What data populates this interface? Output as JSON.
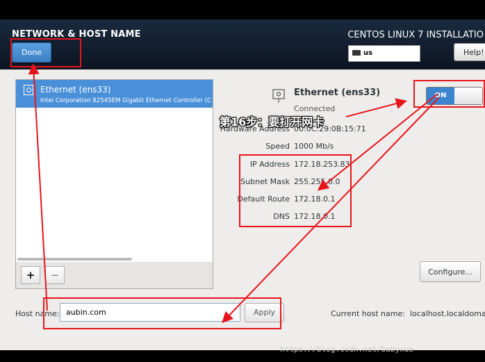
{
  "header": {
    "title": "NETWORK & HOST NAME",
    "done_label": "Done",
    "install_title": "CENTOS LINUX 7 INSTALLATIO",
    "keyboard_layout": "us",
    "help_label": "Help!"
  },
  "connections": {
    "items": [
      {
        "name": "Ethernet (ens33)",
        "description": "Intel Corporation 82545EM Gigabit Ethernet Controller (C"
      }
    ],
    "add_label": "+",
    "remove_label": "−"
  },
  "detail": {
    "name": "Ethernet (ens33)",
    "status": "Connected",
    "toggle_label": "ON",
    "toggle_on": true,
    "hardware_address_label": "Hardware Address",
    "hardware_address_value": "00:0C:29:0B:15:71",
    "speed_label": "Speed",
    "speed_value": "1000 Mb/s",
    "ip_label": "IP Address",
    "ip_value": "172.18.253.83",
    "subnet_label": "Subnet Mask",
    "subnet_value": "255.255.0.0",
    "route_label": "Default Route",
    "route_value": "172.18.0.1",
    "dns_label": "DNS",
    "dns_value": "172.18.0.1",
    "configure_label": "Configure..."
  },
  "hostname": {
    "label": "Host name:",
    "value": "aubin.com",
    "apply_label": "Apply",
    "current_label": "Current host name:",
    "current_value": "localhost.localdomai"
  },
  "annotation": {
    "step_text": "第16步：要打开网卡",
    "color": "#e8141b"
  },
  "watermark": "https://blog.csdn.net/babyxue"
}
